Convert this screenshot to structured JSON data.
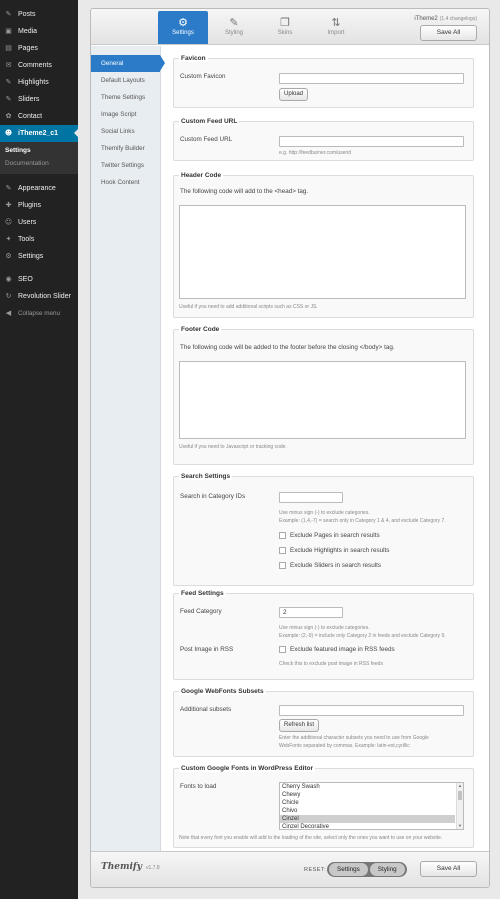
{
  "admin_menu": {
    "items_top": [
      {
        "label": "Posts",
        "icon": "pin-icon",
        "glyph": "✎"
      },
      {
        "label": "Media",
        "icon": "media-icon",
        "glyph": "▣"
      },
      {
        "label": "Pages",
        "icon": "pages-icon",
        "glyph": "▤"
      },
      {
        "label": "Comments",
        "icon": "comments-icon",
        "glyph": "✉"
      },
      {
        "label": "Highlights",
        "icon": "highlights-icon",
        "glyph": "✎"
      },
      {
        "label": "Sliders",
        "icon": "sliders-icon",
        "glyph": "✎"
      },
      {
        "label": "Contact",
        "icon": "contact-icon",
        "glyph": "✿"
      }
    ],
    "current": {
      "label": "iTheme2_c1",
      "icon": "theme-smiley-icon",
      "glyph": "☻"
    },
    "submenu": [
      "Settings",
      "Documentation"
    ],
    "items_bottom": [
      {
        "label": "Appearance",
        "icon": "appearance-icon",
        "glyph": "✎"
      },
      {
        "label": "Plugins",
        "icon": "plugins-icon",
        "glyph": "✚"
      },
      {
        "label": "Users",
        "icon": "users-icon",
        "glyph": "☺"
      },
      {
        "label": "Tools",
        "icon": "tools-icon",
        "glyph": "✦"
      },
      {
        "label": "Settings",
        "icon": "settings-icon",
        "glyph": "⚙"
      }
    ],
    "items_extra": [
      {
        "label": "SEO",
        "icon": "seo-icon",
        "glyph": "◉"
      },
      {
        "label": "Revolution Slider",
        "icon": "revolution-icon",
        "glyph": "↻"
      },
      {
        "label": "Collapse menu",
        "icon": "collapse-icon",
        "glyph": "◀"
      }
    ],
    "colors": {
      "background": "#222222",
      "current": "#0074a2"
    }
  },
  "panel": {
    "tabs": [
      {
        "label": "Settings",
        "icon": "gear-icon",
        "glyph": "⚙"
      },
      {
        "label": "Styling",
        "icon": "brush-icon",
        "glyph": "✎"
      },
      {
        "label": "Skins",
        "icon": "skins-icon",
        "glyph": "❐"
      },
      {
        "label": "Import",
        "icon": "import-icon",
        "glyph": "⇅"
      }
    ],
    "theme_name": "iTheme2",
    "theme_meta": "(1.4 changelogs)",
    "save_label": "Save All",
    "accent": "#2b7bc8"
  },
  "subnav": {
    "items": [
      "General",
      "Default Layouts",
      "Theme Settings",
      "Image Script",
      "Social Links",
      "Themify Builder",
      "Twitter Settings",
      "Hook Content"
    ]
  },
  "sections": {
    "favicon": {
      "title": "Favicon",
      "label": "Custom Favicon",
      "value": "",
      "upload_label": "Upload"
    },
    "feed_url": {
      "title": "Custom Feed URL",
      "label": "Custom Feed URL",
      "value": "",
      "help": "e.g. http://feedburner.com/userid"
    },
    "header_code": {
      "title": "Header Code",
      "intro": "The following code will add to the <head> tag.",
      "value": "",
      "help": "Useful if you need to add additional scripts such as CSS or JS."
    },
    "footer_code": {
      "title": "Footer Code",
      "intro": "The following code will be added to the footer before the closing </body> tag.",
      "value": "",
      "help": "Useful if you need to Javascript or tracking code."
    },
    "search": {
      "title": "Search Settings",
      "label": "Search in Category IDs",
      "value": "",
      "help1": "Use minus sign (-) to exclude categories.",
      "help2": "Example: (1,4,-7) = search only in Category 1 & 4, and exclude Category 7.",
      "checkboxes": [
        "Exclude Pages in search results",
        "Exclude Highlights in search results",
        "Exclude Sliders in search results"
      ]
    },
    "feed": {
      "title": "Feed Settings",
      "category_label": "Feed Category",
      "category_value": "2",
      "help1": "Use minus sign (-) to exclude categories.",
      "help2": "Example: (2,-9) = include only Category 2 in feeds and exclude Category 9.",
      "rss_label": "Post Image in RSS",
      "rss_checkbox": "Exclude featured image in RSS feeds",
      "rss_help": "Check this to exclude post image in RSS feeds"
    },
    "webfonts": {
      "title": "Google WebFonts Subsets",
      "label": "Additional subsets",
      "value": "",
      "refresh_label": "Refresh list",
      "help1": "Enter the additional character subsets you need to use from Google",
      "help2": "WebFonts separated by commas. Example: latin-ext,cyrillic"
    },
    "custom_fonts": {
      "title": "Custom Google Fonts in WordPress Editor",
      "label": "Fonts to load",
      "options": [
        "Cherry Swash",
        "Chewy",
        "Chicle",
        "Chivo",
        "Cinzel",
        "Cinzel Decorative"
      ],
      "selected": "Cinzel",
      "help": "Note that every font you enable will add to the loading of the site, select only the ones you want to use on your website."
    }
  },
  "footer": {
    "brand": "Themify",
    "brand_version": "v1.7.8",
    "reset_label": "RESET:",
    "reset_options": [
      "Settings",
      "Styling"
    ],
    "save_label": "Save All"
  }
}
